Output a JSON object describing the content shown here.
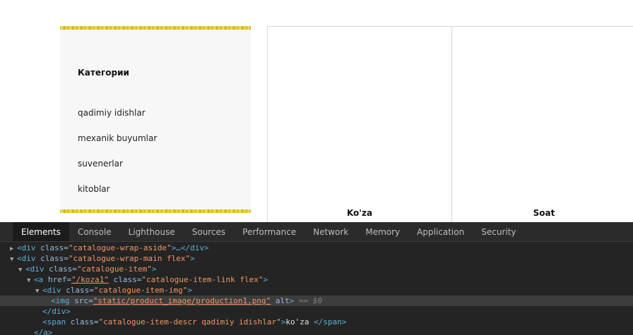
{
  "aside": {
    "title": "Категории",
    "items": [
      "qadimiy idishlar",
      "mexanik buyumlar",
      "suvenerlar",
      "kitoblar"
    ]
  },
  "cards": [
    {
      "label": "Ko'za"
    },
    {
      "label": "Soat"
    }
  ],
  "devtools": {
    "tabs": [
      "Elements",
      "Console",
      "Lighthouse",
      "Sources",
      "Performance",
      "Network",
      "Memory",
      "Application",
      "Security"
    ],
    "active_tab": "Elements",
    "dom": {
      "l1": {
        "tag_open": "<div ",
        "attr": "class=",
        "val": "\"catalogue-wrap-aside\"",
        "rest": ">…</div>"
      },
      "l2": {
        "tag_open": "<div ",
        "attr": "class=",
        "val": "\"catalogue-wrap-main flex\"",
        "rest": ">"
      },
      "l3": {
        "tag_open": "<div ",
        "attr": "class=",
        "val": "\"catalogue-item\"",
        "rest": ">"
      },
      "l4": {
        "tag_open": "<a ",
        "attr1": "href=",
        "val1": "\"/koza1\"",
        "attr2": " class=",
        "val2": "\"catalogue-item-link flex\"",
        "rest": ">"
      },
      "l5": {
        "tag_open": "<div ",
        "attr": "class=",
        "val": "\"catalogue-item-img\"",
        "rest": ">"
      },
      "l6": {
        "tag_open": "<img ",
        "attr1": "src=",
        "val1": "\"static/product_image/production1.png\"",
        "attr2": " alt",
        "rest": ">",
        "marker": " == $0"
      },
      "l7": {
        "text": "</div>"
      },
      "l8": {
        "tag_open": "<span ",
        "attr": "class=",
        "val": "\"catalogue-item-descr qadimiy idishlar\"",
        "gt": ">",
        "content": "ko'za ",
        "close": "</span>"
      },
      "l9": {
        "text": "</a>"
      }
    }
  }
}
